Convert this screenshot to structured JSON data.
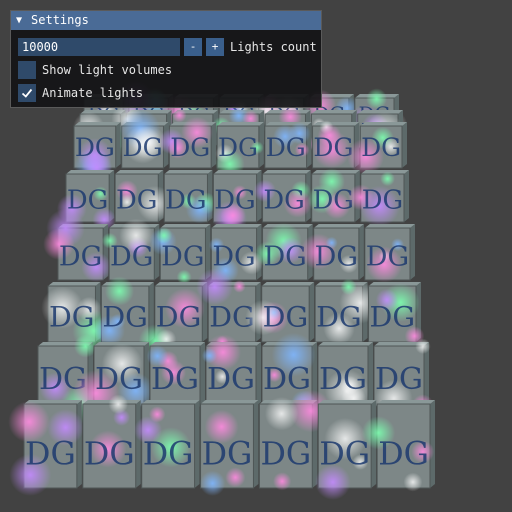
{
  "window": {
    "title": "Settings",
    "collapse_glyph": "▼",
    "accent_color": "#4a6b96"
  },
  "controls": {
    "lights_count": {
      "value": "10000",
      "minus_label": "-",
      "plus_label": "+",
      "label": "Lights count"
    },
    "show_light_volumes": {
      "label": "Show light volumes",
      "checked": false
    },
    "animate_lights": {
      "label": "Animate lights",
      "checked": true
    }
  },
  "scene": {
    "cube_texture_text": "DG",
    "cube_icon": "dg-logo-cube",
    "background_color": "#424242"
  }
}
